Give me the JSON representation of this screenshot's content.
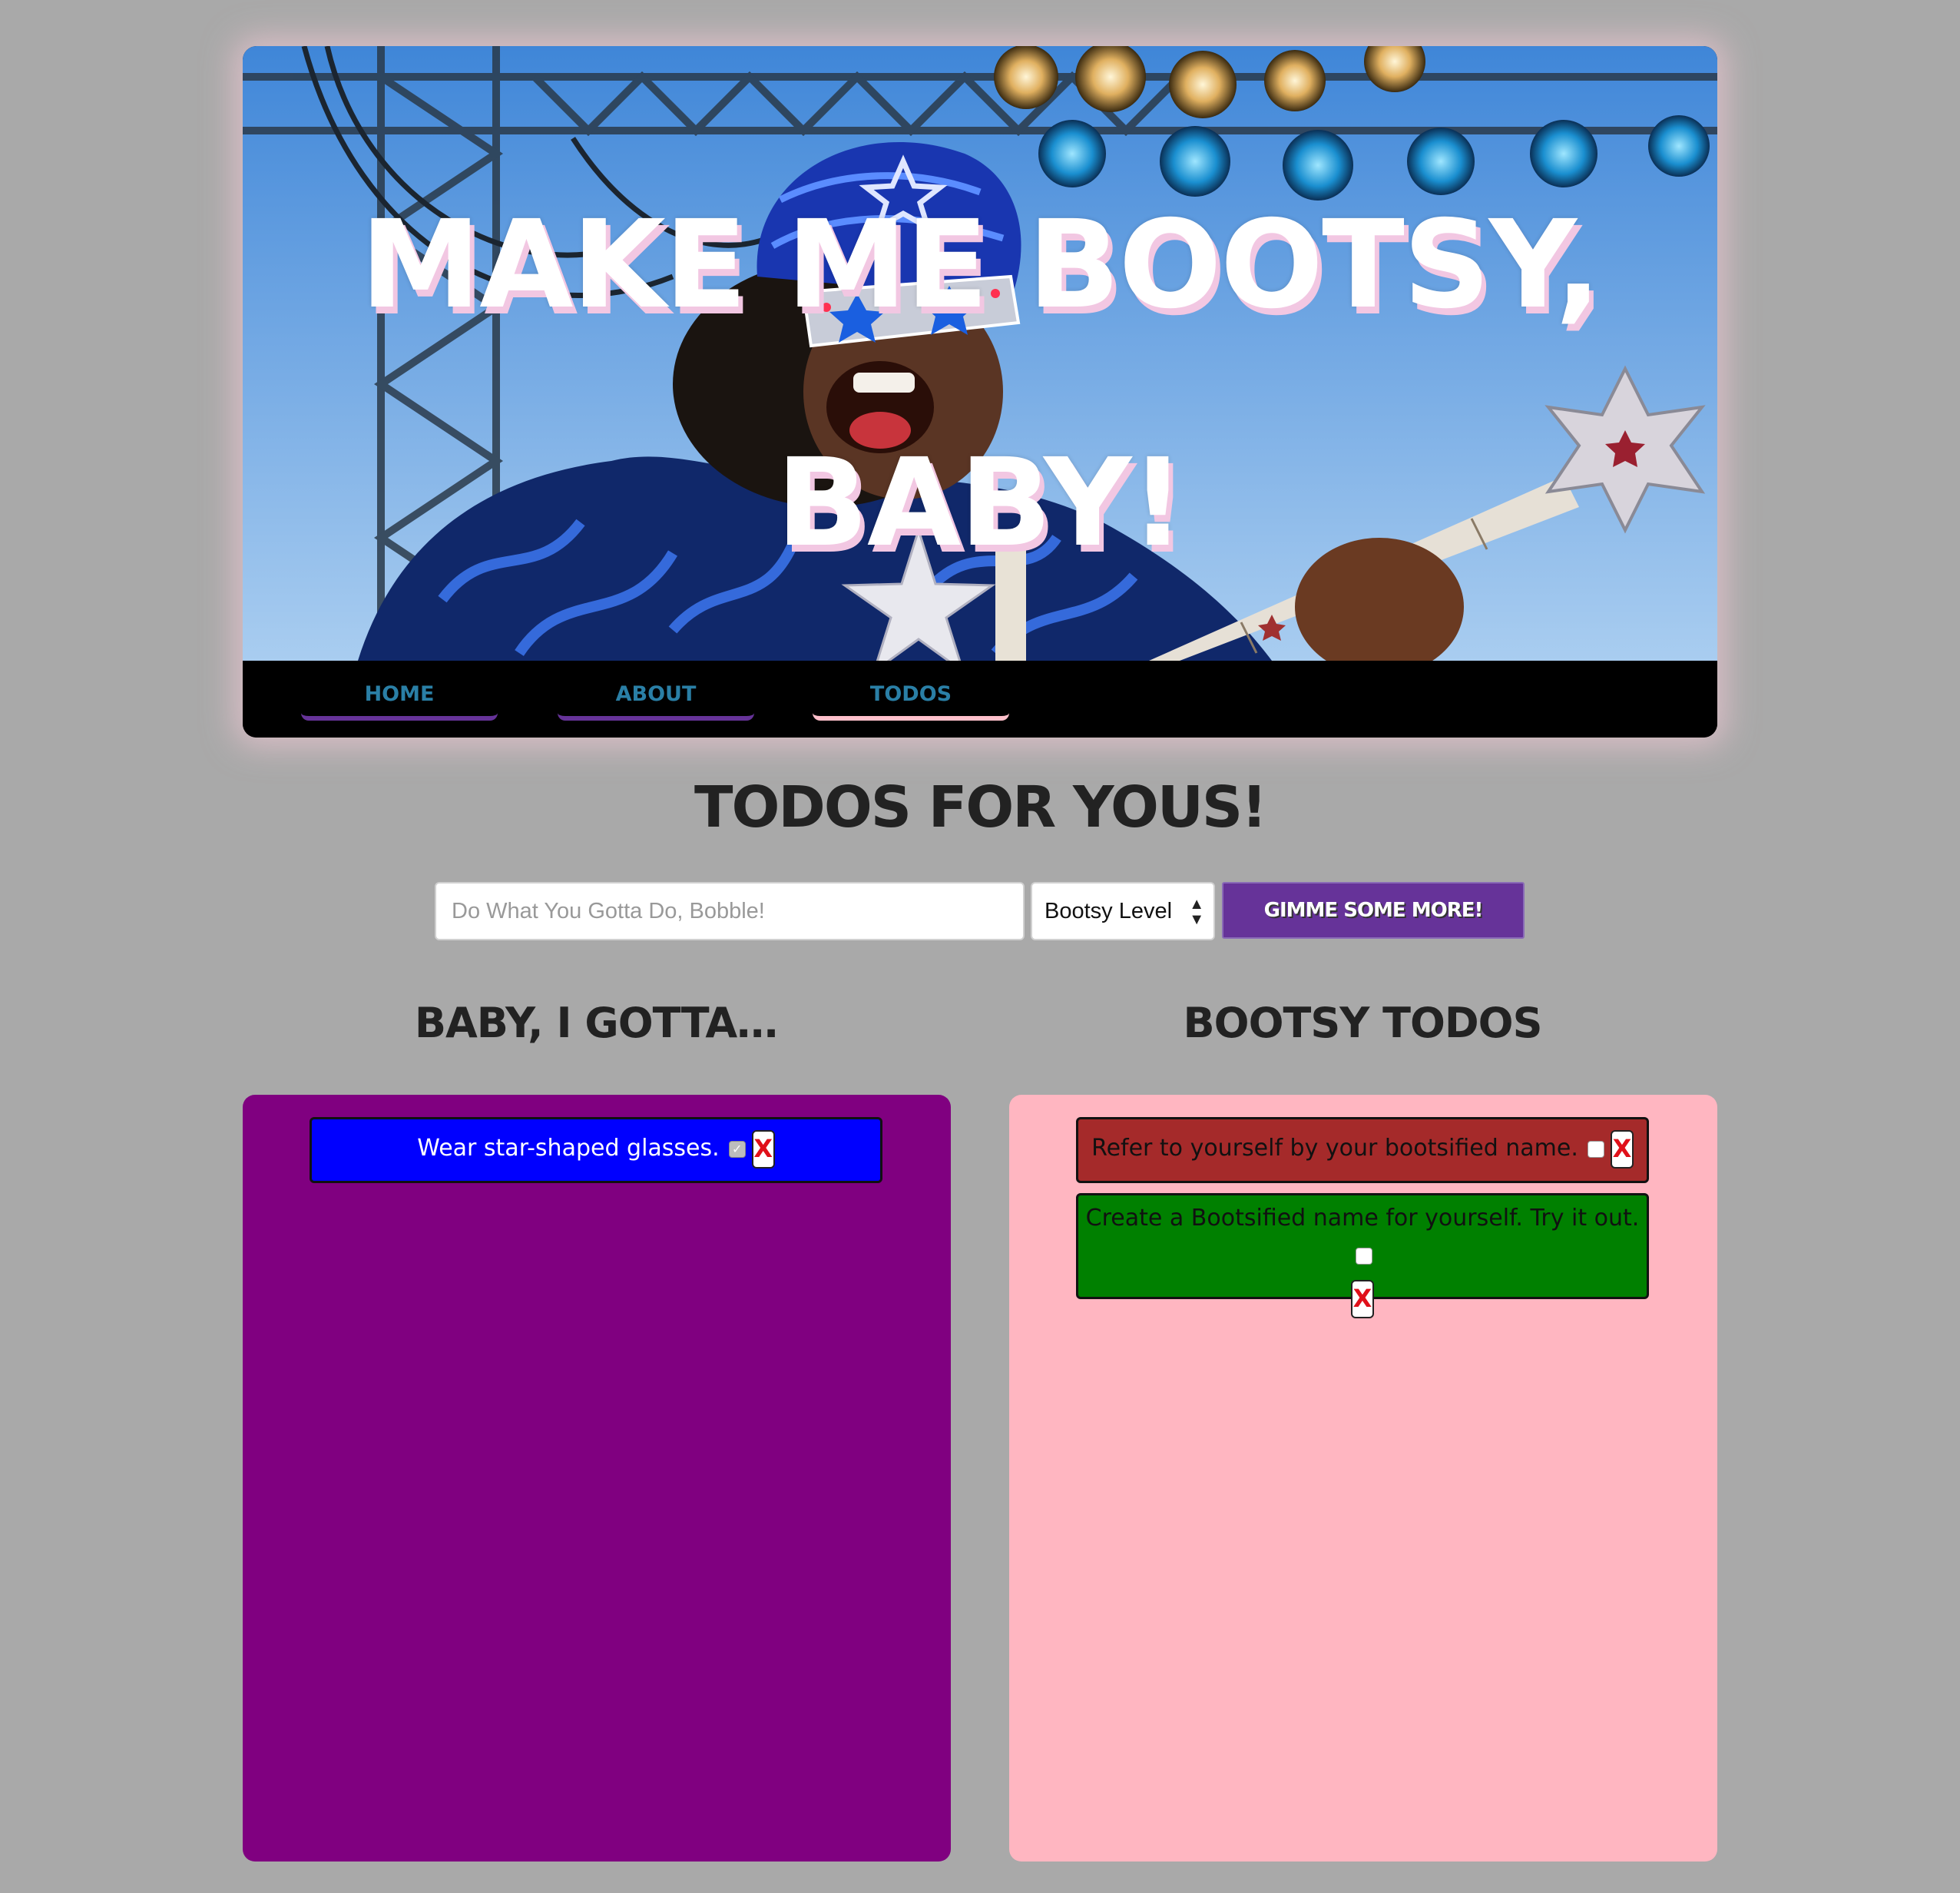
{
  "header": {
    "title_line1": "MAKE ME BOOTSY,",
    "title_line2": "BABY!"
  },
  "nav": {
    "items": [
      {
        "label": "HOME",
        "active": false
      },
      {
        "label": "ABOUT",
        "active": false
      },
      {
        "label": "TODOS",
        "active": true
      }
    ]
  },
  "page": {
    "title": "TODOS FOR YOUS!"
  },
  "form": {
    "input_placeholder": "Do What You Gotta Do, Bobble!",
    "input_value": "",
    "select_value": "Bootsy Level",
    "submit_label": "GIMME SOME MORE!"
  },
  "columns": [
    {
      "heading": "BABY, I GOTTA…",
      "todos": [
        {
          "text": "Wear star-shaped glasses.",
          "checked": true,
          "delete_label": "X",
          "color": "#0000ff",
          "text_color": "#ffffff"
        }
      ]
    },
    {
      "heading": "BOOTSY TODOS",
      "todos": [
        {
          "text": "Refer to yourself by your bootsified name.",
          "checked": false,
          "delete_label": "X",
          "color": "#a52a2a",
          "text_color": "#111111"
        },
        {
          "text": "Create a Bootsified name for yourself. Try it out.",
          "checked": false,
          "delete_label": "X",
          "color": "#008000",
          "text_color": "#111111"
        }
      ]
    }
  ],
  "colors": {
    "background": "#a9a9a9",
    "left_panel": "#800080",
    "right_panel": "#ffb6c1",
    "accent_purple": "#663399",
    "nav_text": "#2a7fa6"
  }
}
